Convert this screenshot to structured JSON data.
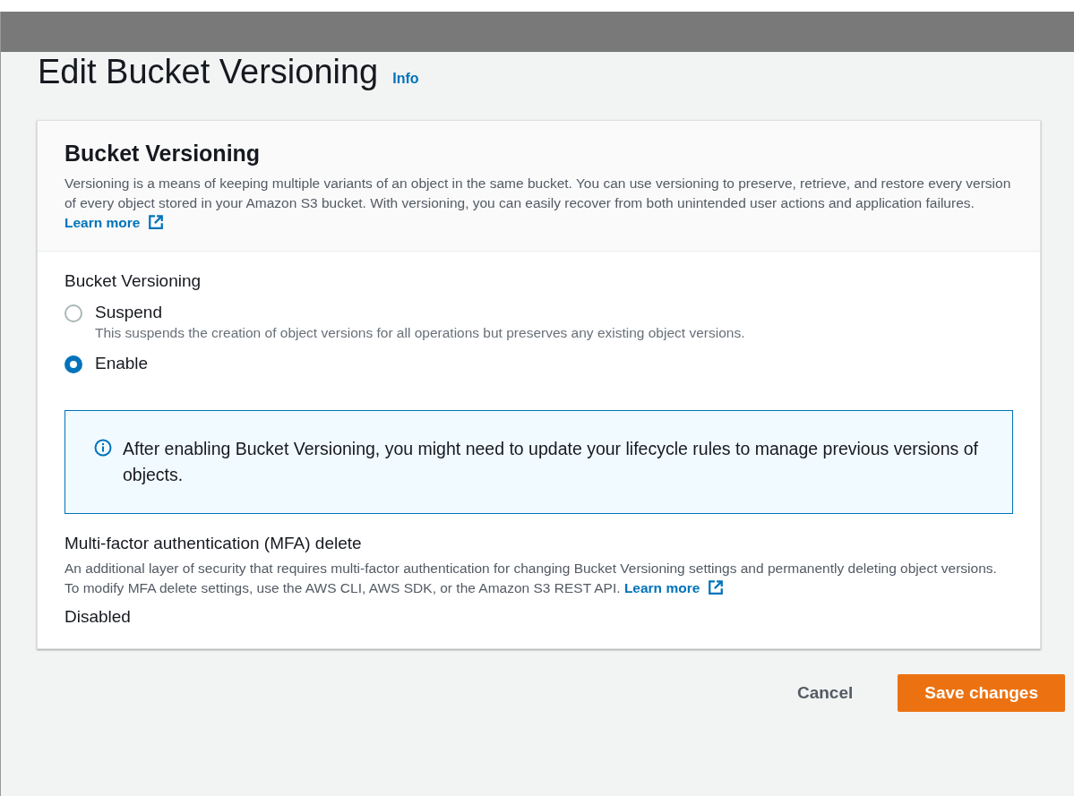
{
  "page": {
    "title": "Edit Bucket Versioning",
    "info_link": "Info"
  },
  "card": {
    "title": "Bucket Versioning",
    "description": "Versioning is a means of keeping multiple variants of an object in the same bucket. You can use versioning to preserve, retrieve, and restore every version of every object stored in your Amazon S3 bucket. With versioning, you can easily recover from both unintended user actions and application failures.",
    "learn_more": "Learn more"
  },
  "versioning": {
    "label": "Bucket Versioning",
    "options": [
      {
        "label": "Suspend",
        "description": "This suspends the creation of object versions for all operations but preserves any existing object versions.",
        "selected": false
      },
      {
        "label": "Enable",
        "selected": true
      }
    ]
  },
  "alert": {
    "kind": "info",
    "text": "After enabling Bucket Versioning, you might need to update your lifecycle rules to manage previous versions of objects."
  },
  "mfa": {
    "label": "Multi-factor authentication (MFA) delete",
    "description": "An additional layer of security that requires multi-factor authentication for changing Bucket Versioning settings and permanently deleting object versions. To modify MFA delete settings, use the AWS CLI, AWS SDK, or the Amazon S3 REST API.",
    "learn_more": "Learn more",
    "value": "Disabled"
  },
  "buttons": [
    {
      "label": "Cancel",
      "kind": "link"
    },
    {
      "label": "Save changes",
      "kind": "primary"
    }
  ]
}
